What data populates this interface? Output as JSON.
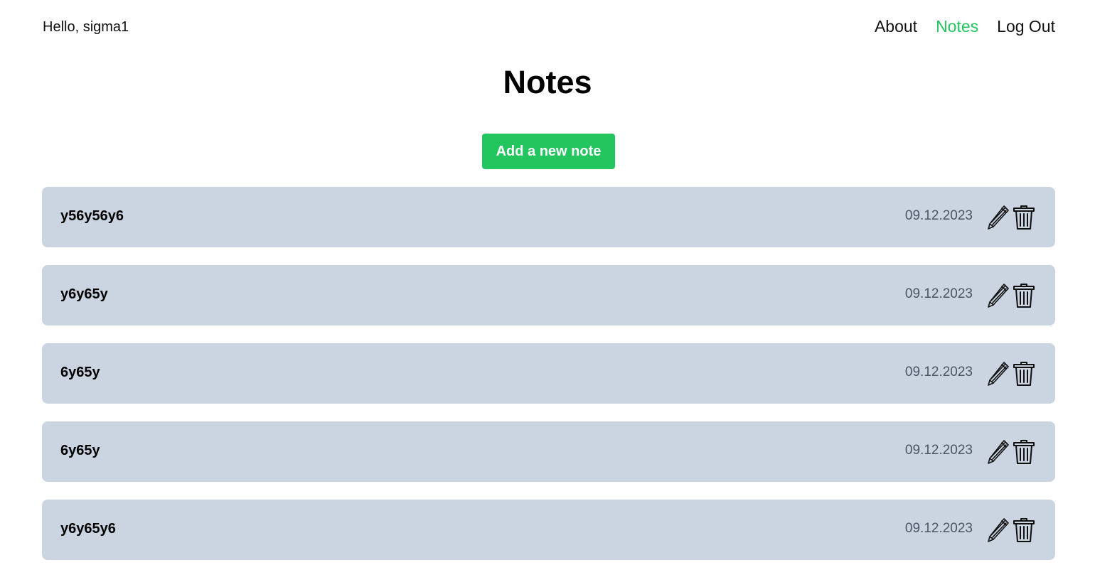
{
  "header": {
    "greeting": "Hello, sigma1",
    "nav": [
      {
        "label": "About",
        "active": false
      },
      {
        "label": "Notes",
        "active": true
      },
      {
        "label": "Log Out",
        "active": false
      }
    ]
  },
  "main": {
    "title": "Notes",
    "add_button_label": "Add a new note",
    "notes": [
      {
        "title": "y56y56y6",
        "date": "09.12.2023",
        "edit_icon": "pencil-icon",
        "delete_icon": "trash-icon"
      },
      {
        "title": "y6y65y",
        "date": "09.12.2023",
        "edit_icon": "pencil-icon",
        "delete_icon": "trash-icon"
      },
      {
        "title": "6y65y",
        "date": "09.12.2023",
        "edit_icon": "pencil-icon",
        "delete_icon": "trash-icon"
      },
      {
        "title": "6y65y",
        "date": "09.12.2023",
        "edit_icon": "pencil-icon",
        "delete_icon": "trash-icon"
      },
      {
        "title": "y6y65y6",
        "date": "09.12.2023",
        "edit_icon": "pencil-icon",
        "delete_icon": "trash-icon"
      }
    ]
  },
  "colors": {
    "accent": "#22c55e",
    "note_background": "#cbd5e1",
    "text": "#111111",
    "date_text": "#4b5563"
  }
}
